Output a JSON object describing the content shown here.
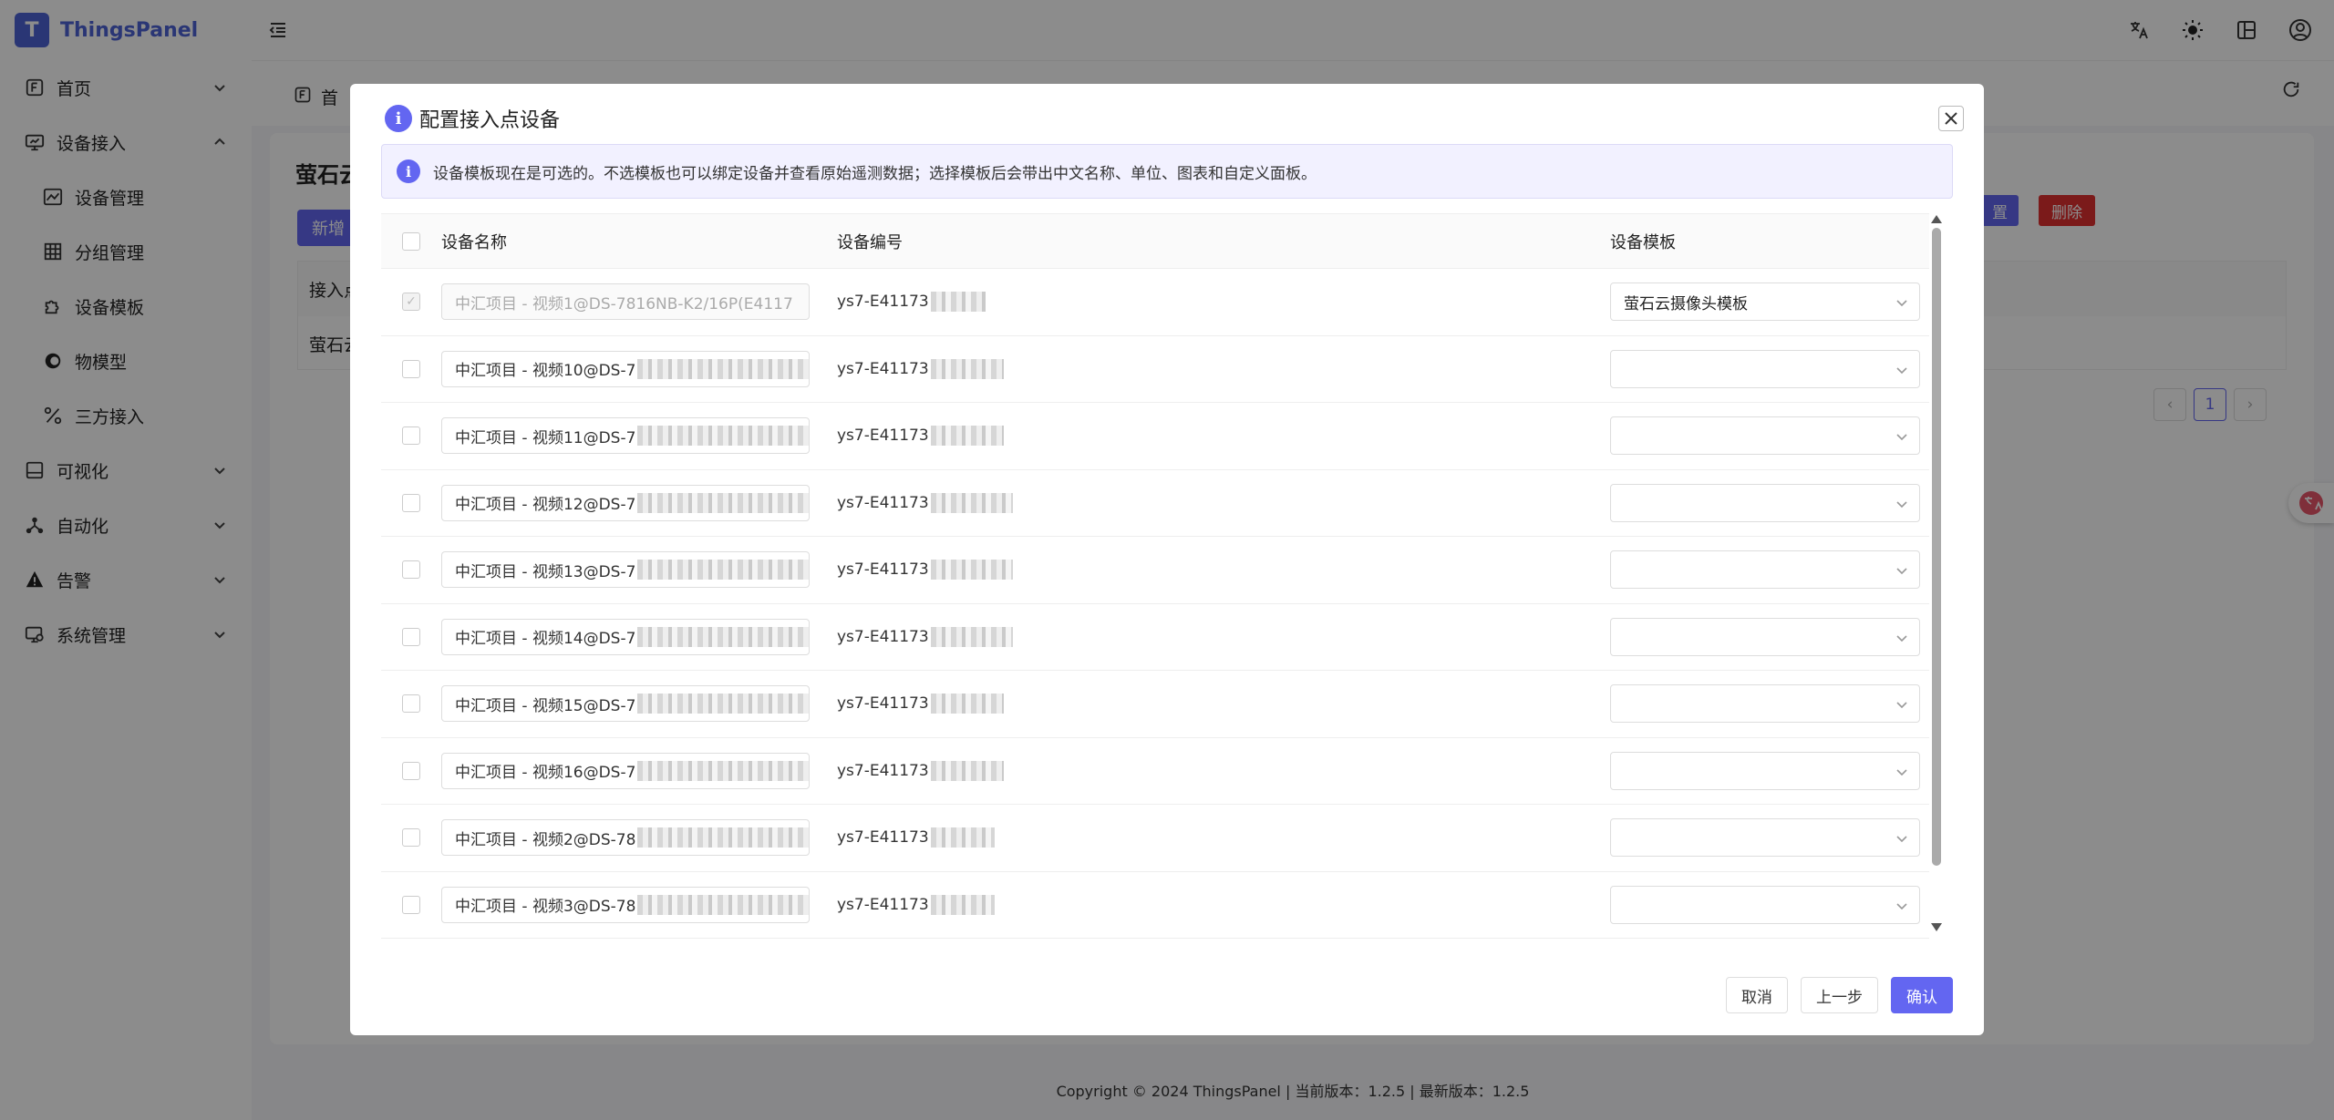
{
  "brand": {
    "name": "ThingsPanel",
    "logo_letter": "T",
    "color": "#4e63d6"
  },
  "sidebar": {
    "items": [
      {
        "label": "首页",
        "icon": "home-icon",
        "expanded": false
      },
      {
        "label": "设备接入",
        "icon": "monitor-icon",
        "expanded": true,
        "children": [
          {
            "label": "设备管理",
            "icon": "chart-icon"
          },
          {
            "label": "分组管理",
            "icon": "grid-icon"
          },
          {
            "label": "设备模板",
            "icon": "puzzle-icon"
          },
          {
            "label": "物模型",
            "icon": "circle-icon"
          },
          {
            "label": "三方接入",
            "icon": "percent-icon"
          }
        ]
      },
      {
        "label": "可视化",
        "icon": "screen-icon",
        "expanded": false
      },
      {
        "label": "自动化",
        "icon": "network-icon",
        "expanded": false
      },
      {
        "label": "告警",
        "icon": "warning-icon",
        "expanded": false
      },
      {
        "label": "系统管理",
        "icon": "settings-monitor-icon",
        "expanded": false
      }
    ]
  },
  "tabs": {
    "first": "首"
  },
  "background_page": {
    "title": "萤石云",
    "add_button": "新增",
    "table_head": "接入点",
    "table_row": "萤石云",
    "edit": "置",
    "delete": "删除",
    "page": "1"
  },
  "footer": {
    "text": "Copyright © 2024 ThingsPanel  |  当前版本：1.2.5  |  最新版本：1.2.5"
  },
  "modal": {
    "title": "配置接入点设备",
    "alert": "设备模板现在是可选的。不选模板也可以绑定设备并查看原始遥测数据；选择模板后会带出中文名称、单位、图表和自定义面板。",
    "columns": {
      "name": "设备名称",
      "code": "设备编号",
      "template": "设备模板"
    },
    "rows": [
      {
        "name": "中汇项目 - 视频1@DS-7816NB-K2/16P(E4117",
        "code": "ys7-E41173",
        "template": "萤石云摄像头模板",
        "checked": true,
        "disabled": true
      },
      {
        "name": "中汇项目 - 视频10@DS-7",
        "code": "ys7-E41173",
        "template": "",
        "checked": false
      },
      {
        "name": "中汇项目 - 视频11@DS-7",
        "code": "ys7-E41173",
        "template": "",
        "checked": false
      },
      {
        "name": "中汇项目 - 视频12@DS-7",
        "code": "ys7-E41173",
        "template": "",
        "checked": false
      },
      {
        "name": "中汇项目 - 视频13@DS-7",
        "code": "ys7-E41173",
        "template": "",
        "checked": false
      },
      {
        "name": "中汇项目 - 视频14@DS-7",
        "code": "ys7-E41173",
        "template": "",
        "checked": false
      },
      {
        "name": "中汇项目 - 视频15@DS-7",
        "code": "ys7-E41173",
        "template": "",
        "checked": false
      },
      {
        "name": "中汇项目 - 视频16@DS-7",
        "code": "ys7-E41173",
        "template": "",
        "checked": false
      },
      {
        "name": "中汇项目 - 视频2@DS-78",
        "code": "ys7-E41173",
        "template": "",
        "checked": false
      },
      {
        "name": "中汇项目 - 视频3@DS-78",
        "code": "ys7-E41173",
        "template": "",
        "checked": false
      }
    ],
    "buttons": {
      "cancel": "取消",
      "prev": "上一步",
      "confirm": "确认"
    }
  },
  "colors": {
    "primary": "#6366f1",
    "danger": "#e03131"
  }
}
